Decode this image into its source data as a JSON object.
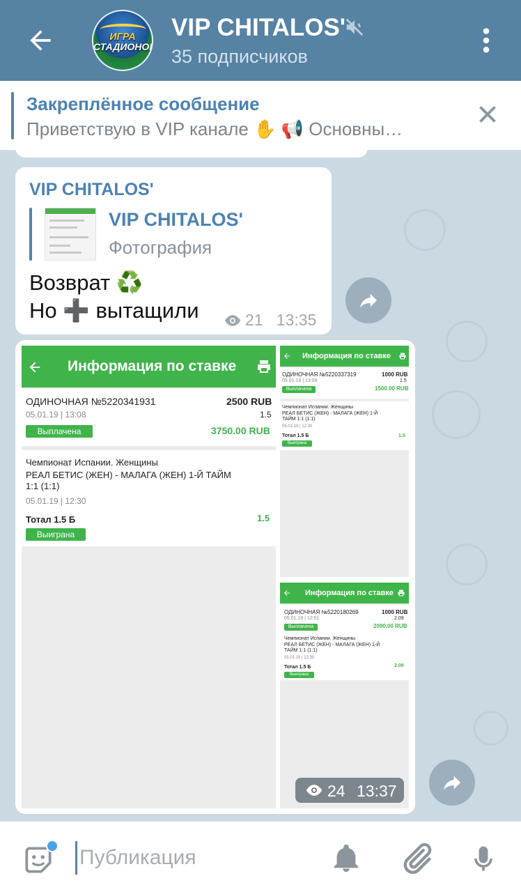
{
  "header": {
    "title": "VIP CHITALOS'",
    "subtitle": "35 подписчиков",
    "avatar_line1": "ИГРА",
    "avatar_line2": "СТАДИОНОВ"
  },
  "pinned": {
    "title": "Закреплённое сообщение",
    "text": "Приветствую в VIP канале ✋ 📢 Основны…"
  },
  "message1": {
    "author": "VIP CHITALOS'",
    "reply_author": "VIP CHITALOS'",
    "reply_type": "Фотография",
    "line1": "Возврат ♻️",
    "line2": "Но ➕ вытащили",
    "views": "21",
    "time": "13:35"
  },
  "album": {
    "views": "24",
    "time": "13:37",
    "shot1": {
      "header": "Информация по ставке",
      "bet_type": "ОДИНОЧНАЯ №5220341931",
      "amount": "2500 RUB",
      "date": "05.01.19 | 13:08",
      "coef": "1.5",
      "status": "Выплачена",
      "payout": "3750.00 RUB",
      "league": "Чемпионат Испании. Женщины",
      "match": "РЕАЛ БЕТИС (ЖЕН) - МАЛАГА (ЖЕН) 1-Й ТАЙМ 1:1 (1:1)",
      "match_date": "05.01.19 | 12:30",
      "outcome": "Тотал 1.5 Б",
      "outcome_coef": "1.5",
      "result": "Выиграна"
    },
    "shot2": {
      "header": "Информация по ставке",
      "bet_type": "ОДИНОЧНАЯ №5220337319",
      "amount": "1000 RUB",
      "date": "05.01.19 | 13:08",
      "coef": "1.5",
      "status": "Выплачена",
      "payout": "1500.00 RUB",
      "league": "Чемпионат Испании. Женщины",
      "match": "РЕАЛ БЕТИС (ЖЕН) - МАЛАГА (ЖЕН) 1-Й ТАЙМ 1:1 (1:1)",
      "match_date": "05.01.19 | 12:30",
      "outcome": "Тотал 1.5 Б",
      "outcome_coef": "1.5",
      "result": "Выиграна"
    },
    "shot3": {
      "header": "Информация по ставке",
      "bet_type": "ОДИНОЧНАЯ №5220180269",
      "amount": "1000 RUB",
      "date": "05.01.19 | 12:51",
      "coef": "2.09",
      "status": "Выплачена",
      "payout": "2090.00 RUB",
      "league": "Чемпионат Испании. Женщины",
      "match": "РЕАЛ БЕТИС (ЖЕН) - МАЛАГА (ЖЕН) 1-Й ТАЙМ 1:1 (1:1)",
      "match_date": "05.01.19 | 12:30",
      "outcome": "Тотал 1.5 Б",
      "outcome_coef": "2.09",
      "result": "Выиграна"
    }
  },
  "composer": {
    "placeholder": "Публикация"
  },
  "colors": {
    "header": "#5682a3",
    "accent": "#4b83b4",
    "bet_green": "#3fb44a"
  },
  "icons": [
    "back-arrow-icon",
    "mute-icon",
    "more-vert-icon",
    "close-icon",
    "eye-icon",
    "share-icon",
    "print-icon",
    "sticker-icon",
    "bell-icon",
    "paperclip-icon",
    "mic-icon"
  ]
}
